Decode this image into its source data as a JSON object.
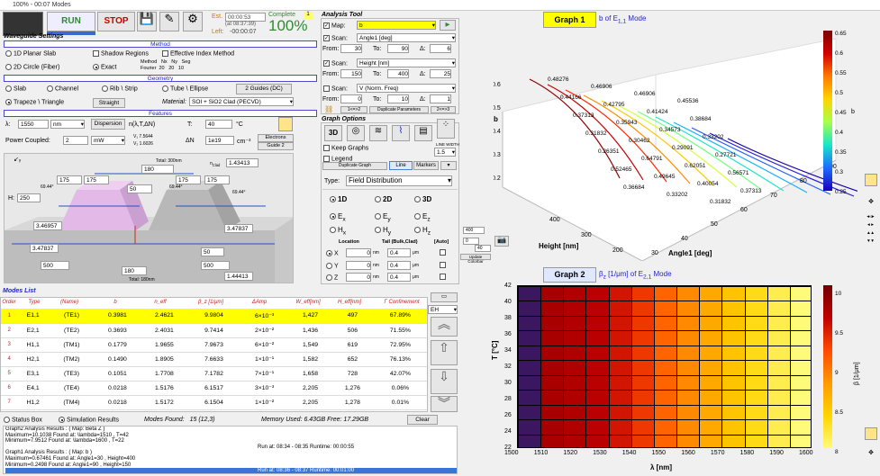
{
  "window": {
    "title": "100% - 00:07 Modes"
  },
  "top": {
    "run": "RUN",
    "stop": "STOP",
    "est_label": "Est.",
    "est_value": "00:00:53",
    "est_time": "(at 08:37:39)",
    "left_label": "Left:",
    "left_value": "-00:00:07",
    "complete_label": "Complete",
    "complete_value": "100%",
    "badge": "1"
  },
  "waveguide_settings": "Waveguide Settings",
  "method": {
    "title": "Method",
    "r1": "1D Planar Slab",
    "r2": "Shadow Regions",
    "r3": "Effective Index Method",
    "r4": "2D Circle (Fiber)",
    "r5": "Exact",
    "grid_headers": [
      "Method",
      "Nx",
      "Ny",
      "Seg"
    ],
    "grid_label": "Fourier",
    "grid_values": [
      "20",
      "20",
      "10"
    ]
  },
  "geometry": {
    "title": "Geometry",
    "slab": "Slab",
    "channel": "Channel",
    "rib": "Rib \\ Strip",
    "tube": "Tube \\ Ellipse",
    "guides": "2 Guides (DC)",
    "trapeze": "Trapeze \\ Triangle",
    "straight": "Straight",
    "material_label": "Material:",
    "material": "SOI + SiO2 Clad (PECVD)"
  },
  "features": {
    "title": "Features",
    "lambda_label": "λ:",
    "lambda": "1550",
    "lambda_unit": "nm",
    "dispersion": "Dispersion",
    "n_label": "n(λ,T,ΔN)",
    "T_label": "T:",
    "T": "40",
    "T_unit": "°C",
    "power_label": "Power Coupled:",
    "power": "2",
    "power_unit": "mW",
    "v1": "7.5644",
    "v2": "1.6026",
    "dn_label": "ΔN",
    "dn": "1e19",
    "dn_unit": "cm⁻³",
    "electrons": "Electrons",
    "guide": "Guide 2"
  },
  "diagram": {
    "total_top": "Total: 300nm",
    "w_top": "180",
    "n_clad": "1.43413",
    "w175a": "175",
    "w175b": "175",
    "w175c": "175",
    "w175d": "175",
    "w_gap": "50",
    "deg1": "69.44°",
    "deg2": "69.44°",
    "deg3": "69.44°",
    "h": "250",
    "n_guide1": "3.46957",
    "n_guide2": "3.47837",
    "n_slab": "3.47837",
    "h_slab": "50",
    "w2": "500",
    "w_gap2": "180",
    "w1": "500",
    "total_bottom": "Total: 180nm",
    "n_bulk": "1.44413"
  },
  "modes": {
    "title": "Modes List",
    "headers": [
      "Order",
      "Type",
      "(Name)",
      "b",
      "n_eff",
      "β_z [1/μm]",
      "ΔAmp",
      "W_eff[nm]",
      "H_eff[nm]",
      "Γ Confinement"
    ],
    "rows": [
      [
        "1",
        "E1,1",
        "(TE1)",
        "0.3981",
        "2.4621",
        "9.9804",
        "6×10⁻³",
        "1,427",
        "497",
        "67.89%"
      ],
      [
        "2",
        "E2,1",
        "(TE2)",
        "0.3693",
        "2.4031",
        "9.7414",
        "2×10⁻²",
        "1,436",
        "506",
        "71.55%"
      ],
      [
        "3",
        "H1,1",
        "(TM1)",
        "0.1779",
        "1.9655",
        "7.9673",
        "6×10⁻²",
        "1,549",
        "619",
        "72.95%"
      ],
      [
        "4",
        "H2,1",
        "(TM2)",
        "0.1490",
        "1.8905",
        "7.6633",
        "1×10⁻¹",
        "1,582",
        "652",
        "76.13%"
      ],
      [
        "5",
        "E3,1",
        "(TE3)",
        "0.1051",
        "1.7708",
        "7.1782",
        "7×10⁻¹",
        "1,658",
        "728",
        "42.07%"
      ],
      [
        "6",
        "E4,1",
        "(TE4)",
        "0.0218",
        "1.5176",
        "6.1517",
        "3×10⁻³",
        "2,205",
        "1,276",
        "0.06%"
      ],
      [
        "7",
        "H1,2",
        "(TM4)",
        "0.0218",
        "1.5172",
        "6.1504",
        "1×10⁻²",
        "2,205",
        "1,278",
        "0.01%"
      ]
    ],
    "eh": "EH"
  },
  "status": {
    "tab1": "Status Box",
    "tab2": "Simulation Results",
    "modes_found": "Modes Found:",
    "modes_found_val": "15 (12,3)",
    "memory": "Memory Used: 6.43GB  Free: 17.29GB",
    "clear": "Clear",
    "lines": [
      "Graph2 Analysis Results : ( Map: Beta Z )",
      "Maximum=10.1038  Found at: \\lambda=1510 , T=42",
      "Minimum=7.9512  Found at: \\lambda=1600 , T=22",
      "Run at: 08:34 - 08:35   Runtime: 00:00:55",
      "Graph1 Analysis Results : ( Map: b )",
      "Maximum=0.67461  Found at: Angle1=30 , Height=400",
      "Minimum=0.2498  Found at: Angle1=90 , Height=150"
    ],
    "selected": "Run at: 08:36 - 08:37   Runtime: 00:01:00"
  },
  "analysis": {
    "title": "Analysis Tool",
    "map_label": "Map:",
    "map": "b",
    "scan1_label": "Scan:",
    "scan1": "Angle1 [deg]",
    "from": "From:",
    "to": "To:",
    "delta": "Δ:",
    "s1_from": "30",
    "s1_to": "90",
    "s1_d": "6",
    "scan2": "Height [nm]",
    "s2_from": "150",
    "s2_to": "400",
    "s2_d": "25",
    "scan3": "V (Norm. Freq)",
    "s3_from": "0",
    "s3_to": "10",
    "s3_d": "1",
    "swap1": "1<=>2",
    "dup": "Duplicate Parameters",
    "swap2": "2<=>3",
    "graph_options": "Graph Options",
    "keep": "Keep Graphs",
    "legend": "Legend",
    "dup_graph": "Duplicate Graph",
    "line": "Line",
    "markers": "Markers",
    "type_label": "Type:",
    "type": "Field Distribution",
    "d1": "1D",
    "d2": "2D",
    "d3": "3D",
    "ex": "E",
    "ey": "E",
    "ez": "E",
    "hx": "H",
    "hy": "H",
    "hz": "H",
    "location": "Location",
    "tail": "Tail (Bulk,Clad)",
    "auto": "[Auto]",
    "x_val": "0",
    "y_val": "0",
    "z_val": "0",
    "t1": "0.4",
    "t2": "0.4",
    "t3": "0.4",
    "unit": "nm",
    "unit2": "μm",
    "line_width": "LINE WIDTH",
    "lw": "1.5",
    "a_vals": [
      "400",
      "0",
      "40"
    ],
    "update": "Update Colorbar"
  },
  "graph1": {
    "title": "Graph 1",
    "subtitle": "b  of E",
    "sub_tail": "Mode",
    "xlabel": "Angle1 [deg]",
    "ylabel": "Height [nm]",
    "zlabel": "b",
    "x_ticks": [
      "30",
      "40",
      "50",
      "60",
      "70",
      "80",
      "90"
    ],
    "y_ticks": [
      "400",
      "300",
      "200"
    ],
    "z_ticks": [
      "0.6",
      "0.5",
      "0.4",
      "0.3",
      "0.2"
    ],
    "cb_ticks": [
      "0.65",
      "0.6",
      "0.55",
      "0.5",
      "0.45",
      "0.4",
      "0.35",
      "0.3",
      "0.25"
    ],
    "cb_label": "b",
    "contour_labels": [
      "0.48276",
      "0.46906",
      "0.46906",
      "0.45536",
      "0.44166",
      "0.42795",
      "0.41424",
      "0.38684",
      "0.37313",
      "0.35943",
      "0.34573",
      "0.33202",
      "0.31832",
      "0.30462",
      "0.29091",
      "0.27721",
      "0.26351",
      "0.64791",
      "0.62051",
      "0.56571",
      "0.52465",
      "0.49645",
      "0.40054",
      "0.37313",
      "0.36684",
      "0.33202",
      "0.31832"
    ]
  },
  "graph2": {
    "title": "Graph 2",
    "subtitle": "β",
    "sub_mid": "[1/μm] of E",
    "sub_tail": "Mode",
    "xlabel": "λ [nm]",
    "ylabel": "T [°C]",
    "x_ticks": [
      "1500",
      "1510",
      "1520",
      "1530",
      "1540",
      "1550",
      "1560",
      "1570",
      "1580",
      "1590",
      "1600"
    ],
    "y_ticks": [
      "42",
      "40",
      "38",
      "36",
      "34",
      "32",
      "30",
      "28",
      "26",
      "24",
      "22"
    ],
    "cb_ticks": [
      "10",
      "9.5",
      "9",
      "8.5",
      "8"
    ],
    "cb_label": "β [1/μm]"
  },
  "chart_data": [
    {
      "type": "heatmap",
      "title": "Graph 2",
      "xlabel": "λ [nm]",
      "ylabel": "T [°C]",
      "x": [
        1500,
        1510,
        1520,
        1530,
        1540,
        1550,
        1560,
        1570,
        1580,
        1590,
        1600
      ],
      "y": [
        22,
        24,
        26,
        28,
        30,
        32,
        34,
        36,
        38,
        40,
        42
      ],
      "columns": [
        10.1,
        9.8,
        9.75,
        9.7,
        9.55,
        9.35,
        9.1,
        8.9,
        8.7,
        8.5,
        8.3,
        8.1,
        7.95
      ],
      "zlim": [
        7.95,
        10.1
      ]
    }
  ],
  "colors": {
    "run": "#2e8b2e",
    "stop": "#c80000",
    "accent": "#2323c8",
    "highlight": "#ffff00"
  }
}
